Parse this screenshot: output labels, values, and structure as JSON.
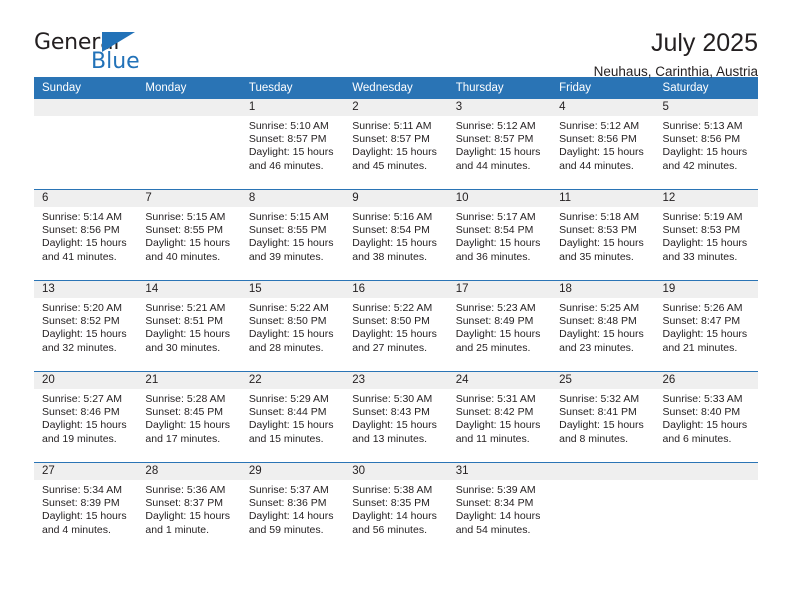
{
  "brand": {
    "name_part1": "General",
    "name_part2": "Blue",
    "accent_color": "#2272b8",
    "triangle_icon": "brand-triangle-icon"
  },
  "header": {
    "title": "July 2025",
    "subtitle": "Neuhaus, Carinthia, Austria"
  },
  "calendar": {
    "header_color": "#2a74b5",
    "day_band_color": "#efefef",
    "weekdays": [
      "Sunday",
      "Monday",
      "Tuesday",
      "Wednesday",
      "Thursday",
      "Friday",
      "Saturday"
    ],
    "weeks": [
      [
        {
          "day": "",
          "sunrise": "",
          "sunset": "",
          "daylight": "",
          "empty": true
        },
        {
          "day": "",
          "sunrise": "",
          "sunset": "",
          "daylight": "",
          "empty": true
        },
        {
          "day": "1",
          "sunrise": "Sunrise: 5:10 AM",
          "sunset": "Sunset: 8:57 PM",
          "daylight": "Daylight: 15 hours and 46 minutes."
        },
        {
          "day": "2",
          "sunrise": "Sunrise: 5:11 AM",
          "sunset": "Sunset: 8:57 PM",
          "daylight": "Daylight: 15 hours and 45 minutes."
        },
        {
          "day": "3",
          "sunrise": "Sunrise: 5:12 AM",
          "sunset": "Sunset: 8:57 PM",
          "daylight": "Daylight: 15 hours and 44 minutes."
        },
        {
          "day": "4",
          "sunrise": "Sunrise: 5:12 AM",
          "sunset": "Sunset: 8:56 PM",
          "daylight": "Daylight: 15 hours and 44 minutes."
        },
        {
          "day": "5",
          "sunrise": "Sunrise: 5:13 AM",
          "sunset": "Sunset: 8:56 PM",
          "daylight": "Daylight: 15 hours and 42 minutes."
        }
      ],
      [
        {
          "day": "6",
          "sunrise": "Sunrise: 5:14 AM",
          "sunset": "Sunset: 8:56 PM",
          "daylight": "Daylight: 15 hours and 41 minutes."
        },
        {
          "day": "7",
          "sunrise": "Sunrise: 5:15 AM",
          "sunset": "Sunset: 8:55 PM",
          "daylight": "Daylight: 15 hours and 40 minutes."
        },
        {
          "day": "8",
          "sunrise": "Sunrise: 5:15 AM",
          "sunset": "Sunset: 8:55 PM",
          "daylight": "Daylight: 15 hours and 39 minutes."
        },
        {
          "day": "9",
          "sunrise": "Sunrise: 5:16 AM",
          "sunset": "Sunset: 8:54 PM",
          "daylight": "Daylight: 15 hours and 38 minutes."
        },
        {
          "day": "10",
          "sunrise": "Sunrise: 5:17 AM",
          "sunset": "Sunset: 8:54 PM",
          "daylight": "Daylight: 15 hours and 36 minutes."
        },
        {
          "day": "11",
          "sunrise": "Sunrise: 5:18 AM",
          "sunset": "Sunset: 8:53 PM",
          "daylight": "Daylight: 15 hours and 35 minutes."
        },
        {
          "day": "12",
          "sunrise": "Sunrise: 5:19 AM",
          "sunset": "Sunset: 8:53 PM",
          "daylight": "Daylight: 15 hours and 33 minutes."
        }
      ],
      [
        {
          "day": "13",
          "sunrise": "Sunrise: 5:20 AM",
          "sunset": "Sunset: 8:52 PM",
          "daylight": "Daylight: 15 hours and 32 minutes."
        },
        {
          "day": "14",
          "sunrise": "Sunrise: 5:21 AM",
          "sunset": "Sunset: 8:51 PM",
          "daylight": "Daylight: 15 hours and 30 minutes."
        },
        {
          "day": "15",
          "sunrise": "Sunrise: 5:22 AM",
          "sunset": "Sunset: 8:50 PM",
          "daylight": "Daylight: 15 hours and 28 minutes."
        },
        {
          "day": "16",
          "sunrise": "Sunrise: 5:22 AM",
          "sunset": "Sunset: 8:50 PM",
          "daylight": "Daylight: 15 hours and 27 minutes."
        },
        {
          "day": "17",
          "sunrise": "Sunrise: 5:23 AM",
          "sunset": "Sunset: 8:49 PM",
          "daylight": "Daylight: 15 hours and 25 minutes."
        },
        {
          "day": "18",
          "sunrise": "Sunrise: 5:25 AM",
          "sunset": "Sunset: 8:48 PM",
          "daylight": "Daylight: 15 hours and 23 minutes."
        },
        {
          "day": "19",
          "sunrise": "Sunrise: 5:26 AM",
          "sunset": "Sunset: 8:47 PM",
          "daylight": "Daylight: 15 hours and 21 minutes."
        }
      ],
      [
        {
          "day": "20",
          "sunrise": "Sunrise: 5:27 AM",
          "sunset": "Sunset: 8:46 PM",
          "daylight": "Daylight: 15 hours and 19 minutes."
        },
        {
          "day": "21",
          "sunrise": "Sunrise: 5:28 AM",
          "sunset": "Sunset: 8:45 PM",
          "daylight": "Daylight: 15 hours and 17 minutes."
        },
        {
          "day": "22",
          "sunrise": "Sunrise: 5:29 AM",
          "sunset": "Sunset: 8:44 PM",
          "daylight": "Daylight: 15 hours and 15 minutes."
        },
        {
          "day": "23",
          "sunrise": "Sunrise: 5:30 AM",
          "sunset": "Sunset: 8:43 PM",
          "daylight": "Daylight: 15 hours and 13 minutes."
        },
        {
          "day": "24",
          "sunrise": "Sunrise: 5:31 AM",
          "sunset": "Sunset: 8:42 PM",
          "daylight": "Daylight: 15 hours and 11 minutes."
        },
        {
          "day": "25",
          "sunrise": "Sunrise: 5:32 AM",
          "sunset": "Sunset: 8:41 PM",
          "daylight": "Daylight: 15 hours and 8 minutes."
        },
        {
          "day": "26",
          "sunrise": "Sunrise: 5:33 AM",
          "sunset": "Sunset: 8:40 PM",
          "daylight": "Daylight: 15 hours and 6 minutes."
        }
      ],
      [
        {
          "day": "27",
          "sunrise": "Sunrise: 5:34 AM",
          "sunset": "Sunset: 8:39 PM",
          "daylight": "Daylight: 15 hours and 4 minutes."
        },
        {
          "day": "28",
          "sunrise": "Sunrise: 5:36 AM",
          "sunset": "Sunset: 8:37 PM",
          "daylight": "Daylight: 15 hours and 1 minute."
        },
        {
          "day": "29",
          "sunrise": "Sunrise: 5:37 AM",
          "sunset": "Sunset: 8:36 PM",
          "daylight": "Daylight: 14 hours and 59 minutes."
        },
        {
          "day": "30",
          "sunrise": "Sunrise: 5:38 AM",
          "sunset": "Sunset: 8:35 PM",
          "daylight": "Daylight: 14 hours and 56 minutes."
        },
        {
          "day": "31",
          "sunrise": "Sunrise: 5:39 AM",
          "sunset": "Sunset: 8:34 PM",
          "daylight": "Daylight: 14 hours and 54 minutes."
        },
        {
          "day": "",
          "sunrise": "",
          "sunset": "",
          "daylight": "",
          "empty": true
        },
        {
          "day": "",
          "sunrise": "",
          "sunset": "",
          "daylight": "",
          "empty": true
        }
      ]
    ]
  }
}
